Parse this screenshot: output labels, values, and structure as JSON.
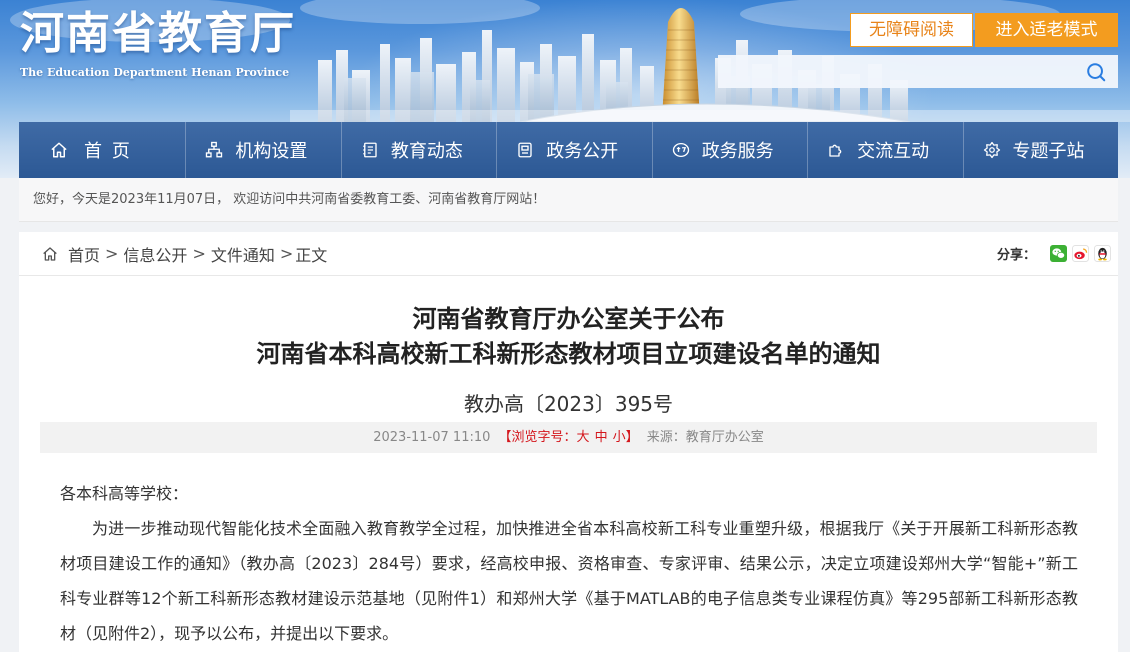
{
  "header": {
    "logo_title": "河南省教育厅",
    "logo_subtitle": "The Education Department Henan Province",
    "accessibility_button_label": "无障碍阅读",
    "elder_mode_button_label": "进入适老模式",
    "search": {
      "icon": "search-icon"
    }
  },
  "nav": {
    "items": [
      {
        "label": "首页",
        "icon": "home-icon"
      },
      {
        "label": "机构设置",
        "icon": "org-chart-icon"
      },
      {
        "label": "教育动态",
        "icon": "news-icon"
      },
      {
        "label": "政务公开",
        "icon": "clipboard-icon"
      },
      {
        "label": "政务服务",
        "icon": "government-service-icon"
      },
      {
        "label": "交流互动",
        "icon": "interaction-icon"
      },
      {
        "label": "专题子站",
        "icon": "topic-site-icon"
      }
    ]
  },
  "welcome": {
    "message": "您好，今天是2023年11月07日， 欢迎访问中共河南省委教育工委、河南省教育厅网站！"
  },
  "breadcrumb": {
    "icon": "home-icon",
    "separator": ">",
    "items": [
      {
        "label": "首页"
      },
      {
        "label": "信息公开"
      },
      {
        "label": "文件通知"
      },
      {
        "label": "正文"
      }
    ]
  },
  "share": {
    "label": "分享：",
    "icons": [
      "wechat-icon",
      "weibo-icon",
      "qq-icon"
    ]
  },
  "article": {
    "title_lines": [
      "河南省教育厅办公室关于公布",
      "河南省本科高校新工科新形态教材项目立项建设名单的通知"
    ],
    "doc_number": "教办高〔2023〕395号",
    "meta": {
      "datetime": "2023-11-07 11:10",
      "font_size_prefix": "【浏览字号：",
      "font_sizes": [
        "大",
        "中",
        "小"
      ],
      "font_size_suffix": "】",
      "source": "来源：教育厅办公室"
    },
    "greeting": "各本科高等学校：",
    "paragraphs": [
      "为进一步推动现代智能化技术全面融入教育教学全过程，加快推进全省本科高校新工科专业重塑升级，根据我厅《关于开展新工科新形态教材项目建设工作的通知》（教办高〔2023〕284号）要求，经高校申报、资格审查、专家评审、结果公示，决定立项建设郑州大学“智能+”新工科专业群等12个新工科新形态教材建设示范基地（见附件1）和郑州大学《基于MATLAB的电子信息类专业课程仿真》等295部新工科新形态教材（见附件2），现予以公布，并提出以下要求。"
    ]
  },
  "colors": {
    "nav_background": "#2f5e9e",
    "accent_orange": "#f39c1f",
    "accessibility_text": "#e8841a",
    "font_size_red": "#d4161c",
    "meta_background": "#f2f2f2",
    "search_icon": "#2a7de1",
    "page_background": "#f0f2f5"
  }
}
